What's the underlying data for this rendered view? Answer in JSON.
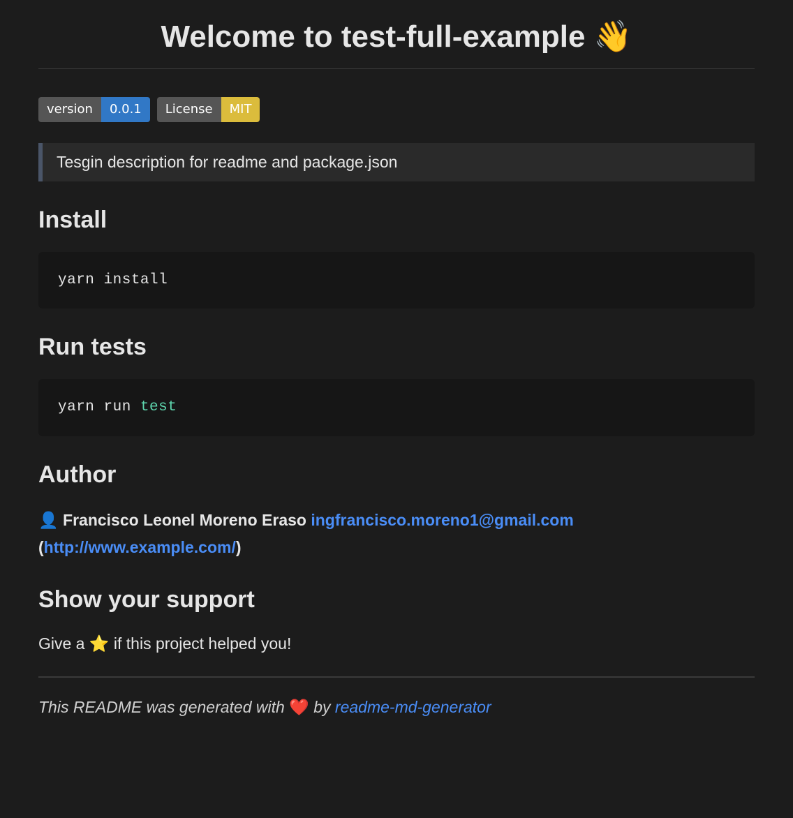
{
  "title": "Welcome to test-full-example 👋",
  "badges": [
    {
      "label": "version",
      "value": "0.0.1",
      "color": "blue"
    },
    {
      "label": "License",
      "value": "MIT",
      "color": "yellow"
    }
  ],
  "description": "Tesgin description for readme and package.json",
  "sections": {
    "install": {
      "heading": "Install",
      "command": "yarn install"
    },
    "run_tests": {
      "heading": "Run tests",
      "command_prefix": "yarn run ",
      "command_highlight": "test"
    },
    "author": {
      "heading": "Author",
      "icon": "👤",
      "name": "Francisco Leonel Moreno Eraso",
      "email": "ingfrancisco.moreno1@gmail.com",
      "website": "http://www.example.com/"
    },
    "support": {
      "heading": "Show your support",
      "text_prefix": "Give a ",
      "icon": "⭐️",
      "text_suffix": " if this project helped you!"
    }
  },
  "footer": {
    "text_prefix": "This README was generated with ",
    "heart": "❤️",
    "text_mid": " by ",
    "link_text": "readme-md-generator"
  }
}
